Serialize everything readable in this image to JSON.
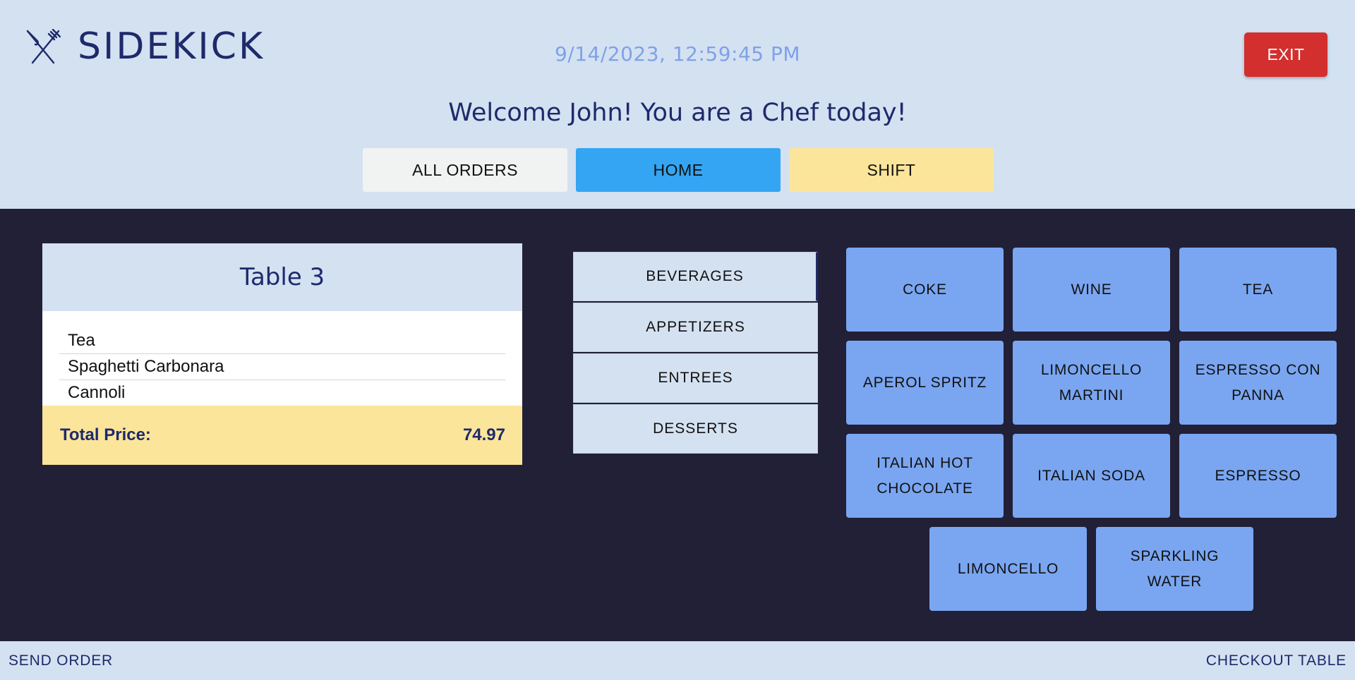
{
  "brand": {
    "name": "SIDEKICK",
    "icon": "fork-knife-crossed-icon"
  },
  "datetime": "9/14/2023, 12:59:45 PM",
  "exit_label": "EXIT",
  "welcome": "Welcome John! You are a Chef today!",
  "nav": {
    "all_orders": "ALL ORDERS",
    "home": "HOME",
    "shift": "SHIFT"
  },
  "order": {
    "title": "Table 3",
    "items": [
      "Tea",
      "Spaghetti Carbonara",
      "Cannoli"
    ],
    "total_label": "Total Price:",
    "total_value": "74.97"
  },
  "categories": [
    "BEVERAGES",
    "APPETIZERS",
    "ENTREES",
    "DESSERTS"
  ],
  "active_category": "BEVERAGES",
  "menu_items": [
    "COKE",
    "WINE",
    "TEA",
    "APEROL SPRITZ",
    "LIMONCELLO MARTINI",
    "ESPRESSO CON PANNA",
    "ITALIAN HOT CHOCOLATE",
    "ITALIAN SODA",
    "ESPRESSO",
    "LIMONCELLO",
    "SPARKLING WATER"
  ],
  "footer": {
    "send": "SEND ORDER",
    "checkout": "CHECKOUT TABLE"
  },
  "colors": {
    "background": "#d4e1f1",
    "panel": "#212036",
    "accent_blue": "#33a5f3",
    "item_blue": "#7aa6f1",
    "yellow": "#fbe59a",
    "exit_red": "#d32f2f",
    "navy": "#1e2a6b"
  }
}
